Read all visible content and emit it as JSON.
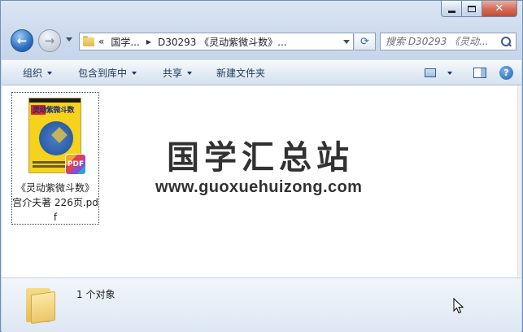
{
  "window": {
    "min_label": "—",
    "close_label": "✕"
  },
  "nav": {
    "back_glyph": "←",
    "forward_glyph": "→"
  },
  "address": {
    "overflow": "«",
    "crumbs": [
      "国学...",
      "D30293 《灵动紫微斗数》..."
    ],
    "separator": "▶"
  },
  "search": {
    "placeholder": "搜索 D30293 《灵动..."
  },
  "toolbar": {
    "organize": "组织",
    "include_in_library": "包含到库中",
    "share": "共享",
    "new_folder": "新建文件夹"
  },
  "file": {
    "name": "《灵动紫微斗数》 宫介夫著 226页.pdf",
    "thumb_title": "灵动紫微斗数",
    "badge": "PDF"
  },
  "watermark": {
    "title": "国学汇总站",
    "url": "www.guoxuehuizong.com"
  },
  "details": {
    "count": "1 个对象"
  },
  "colors": {
    "accent": "#1e395b",
    "cover_yellow": "#f6d21d",
    "close_red": "#c44a33"
  }
}
